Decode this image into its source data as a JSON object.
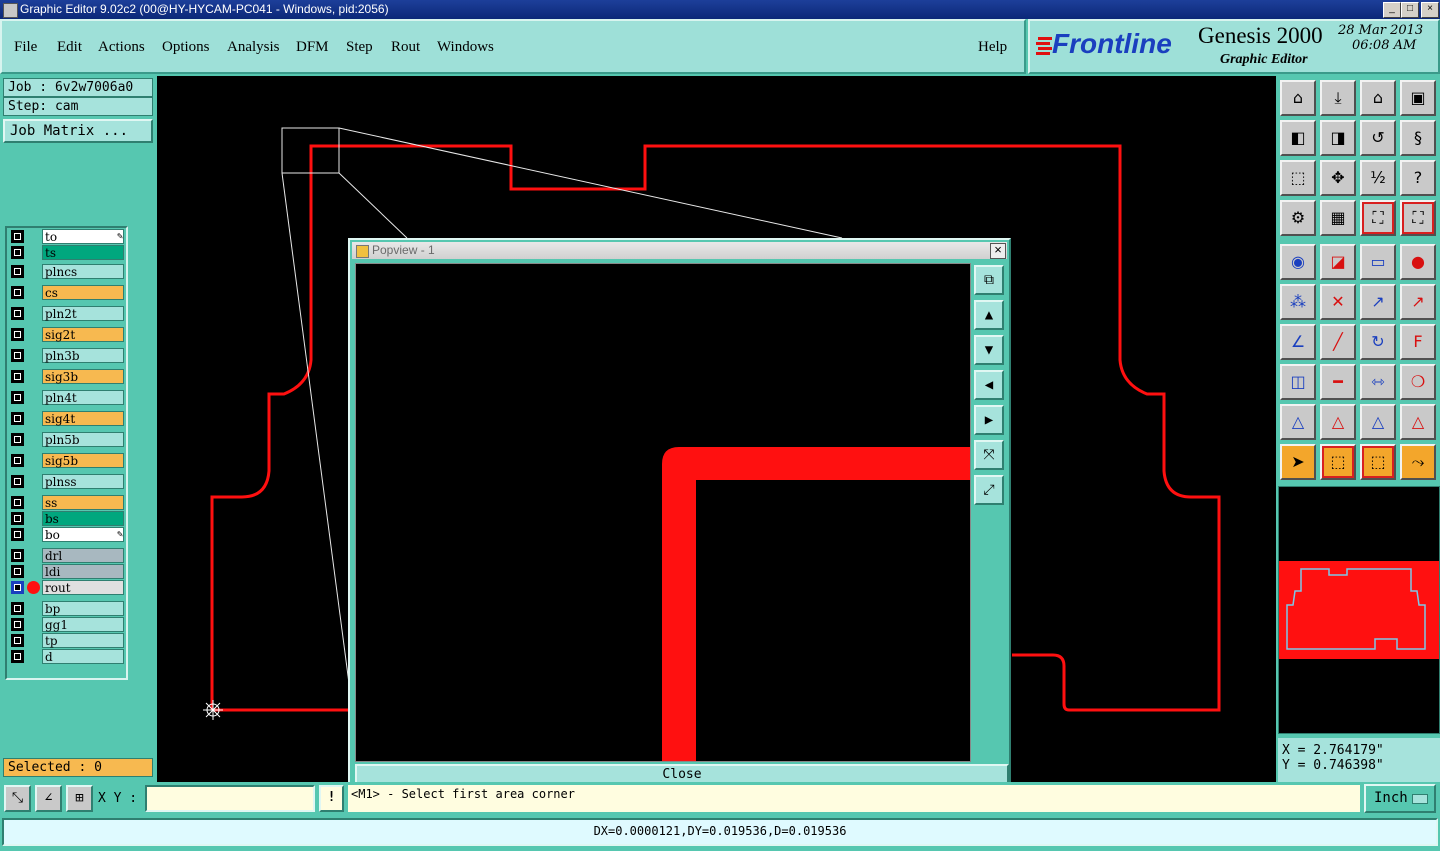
{
  "window": {
    "title": "Graphic Editor 9.02c2 (00@HY-HYCAM-PC041 - Windows, pid:2056)",
    "min_symbol": "_",
    "max_symbol": "□",
    "close_symbol": "×"
  },
  "menu": {
    "items": [
      "File",
      "Edit",
      "Actions",
      "Options",
      "Analysis",
      "DFM",
      "Step",
      "Rout",
      "Windows"
    ],
    "help": "Help"
  },
  "brand": {
    "logo": "Frontline",
    "product": "Genesis 2000",
    "subtitle": "Graphic Editor",
    "date": "28 Mar 2013",
    "time": "06:08 AM"
  },
  "job": {
    "job_label": "Job : 6v2w7006a0",
    "step_label": "Step: cam",
    "matrix_button": "Job Matrix ..."
  },
  "layers": [
    {
      "name": "to",
      "color": "#ffffff",
      "marker": "pencil"
    },
    {
      "name": "ts",
      "color": "#00a77e"
    },
    {
      "name": "plncs",
      "color": "#a6e3dc"
    },
    {
      "name": "cs",
      "color": "#f7b950"
    },
    {
      "name": "pln2t",
      "color": "#a6e3dc"
    },
    {
      "name": "sig2t",
      "color": "#f7b950"
    },
    {
      "name": "pln3b",
      "color": "#a6e3dc"
    },
    {
      "name": "sig3b",
      "color": "#f7b950"
    },
    {
      "name": "pln4t",
      "color": "#a6e3dc"
    },
    {
      "name": "sig4t",
      "color": "#f7b950"
    },
    {
      "name": "pln5b",
      "color": "#a6e3dc"
    },
    {
      "name": "sig5b",
      "color": "#f7b950"
    },
    {
      "name": "plnss",
      "color": "#a6e3dc"
    },
    {
      "name": "ss",
      "color": "#f7b950"
    },
    {
      "name": "bs",
      "color": "#00a77e"
    },
    {
      "name": "bo",
      "color": "#ffffff",
      "marker": "pencil"
    },
    {
      "name": "drl",
      "color": "#a8b8c0"
    },
    {
      "name": "ldi",
      "color": "#a8b8c0"
    },
    {
      "name": "rout",
      "color": "#e0e0e0",
      "active": true
    },
    {
      "name": "bp",
      "color": "#a6e3dc"
    },
    {
      "name": "gg1",
      "color": "#a6e3dc"
    },
    {
      "name": "tp",
      "color": "#a6e3dc"
    },
    {
      "name": "d",
      "color": "#a6e3dc"
    }
  ],
  "selected_label": "Selected : 0",
  "popview": {
    "title": "Popview - 1",
    "close_button": "Close",
    "close_x": "×"
  },
  "coordinates": {
    "x": "X = 2.764179\"",
    "y": "Y = 0.746398\""
  },
  "input": {
    "xy_label": "X Y :",
    "xy_value": "",
    "bang": "!",
    "prompt": "<M1> - Select first area corner",
    "units": "Inch"
  },
  "status": {
    "measure": "DX=0.0000121,DY=0.019536,D=0.019536"
  },
  "colors": {
    "panel": "#56c7b0",
    "rout": "#ff0000",
    "highlight": "#f3a62b"
  }
}
